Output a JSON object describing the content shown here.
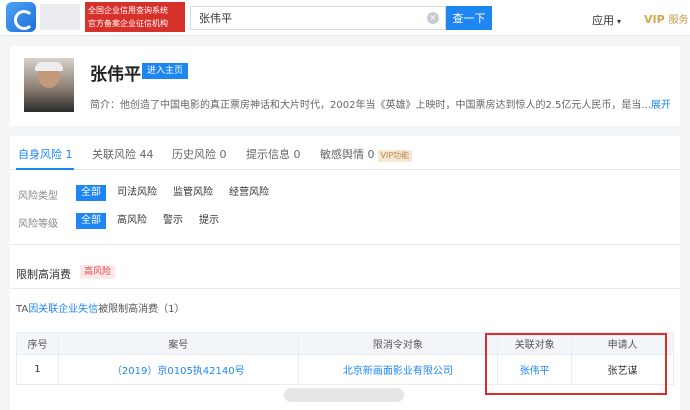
{
  "header": {
    "badge_line1": "全国企业信用查询系统",
    "badge_line2": "官方备案企业征信机构",
    "search_value": "张伟平",
    "clear_icon": "×",
    "search_button": "查一下",
    "apps_label": "应用",
    "apps_caret": "▾",
    "vip_label": "VIP",
    "vip_suffix": "服务"
  },
  "profile": {
    "name": "张伟平",
    "enter_button": "进入主页",
    "intro_text": "简介：他创造了中国电影的真正票房神话和大片时代，2002年当《英雄》上映时，中国票房达到惊人的2.5亿元人民币，是当...",
    "intro_more": "展开"
  },
  "risk_tabs": [
    {
      "label": "自身风险 1"
    },
    {
      "label": "关联风险 44"
    },
    {
      "label": "历史风险 0"
    },
    {
      "label": "提示信息 0"
    },
    {
      "label": "敏感舆情 0"
    }
  ],
  "vip_tag": "VIP功能",
  "filters": {
    "type_label": "风险类型",
    "type_chips": [
      "全部",
      "司法风险",
      "监管风险",
      "经营风险"
    ],
    "level_label": "风险等级",
    "level_chips": [
      "全部",
      "高风险",
      "警示",
      "提示"
    ]
  },
  "section": {
    "title": "限制高消费",
    "tag": "高风险",
    "summary_prefix": "TA",
    "summary_link": "因关联企业失信",
    "summary_suffix": "被限制高消费（1）"
  },
  "table": {
    "headers": [
      "序号",
      "案号",
      "限消令对象",
      "关联对象",
      "申请人"
    ],
    "rows": [
      [
        "1",
        "（2019）京0105执42140号",
        "北京新画面影业有限公司",
        "张伟平",
        "张艺谋"
      ]
    ]
  },
  "colors": {
    "accent": "#1e86f0",
    "highlight_frame": "#e02b2b",
    "brand_red": "#d7312c"
  }
}
